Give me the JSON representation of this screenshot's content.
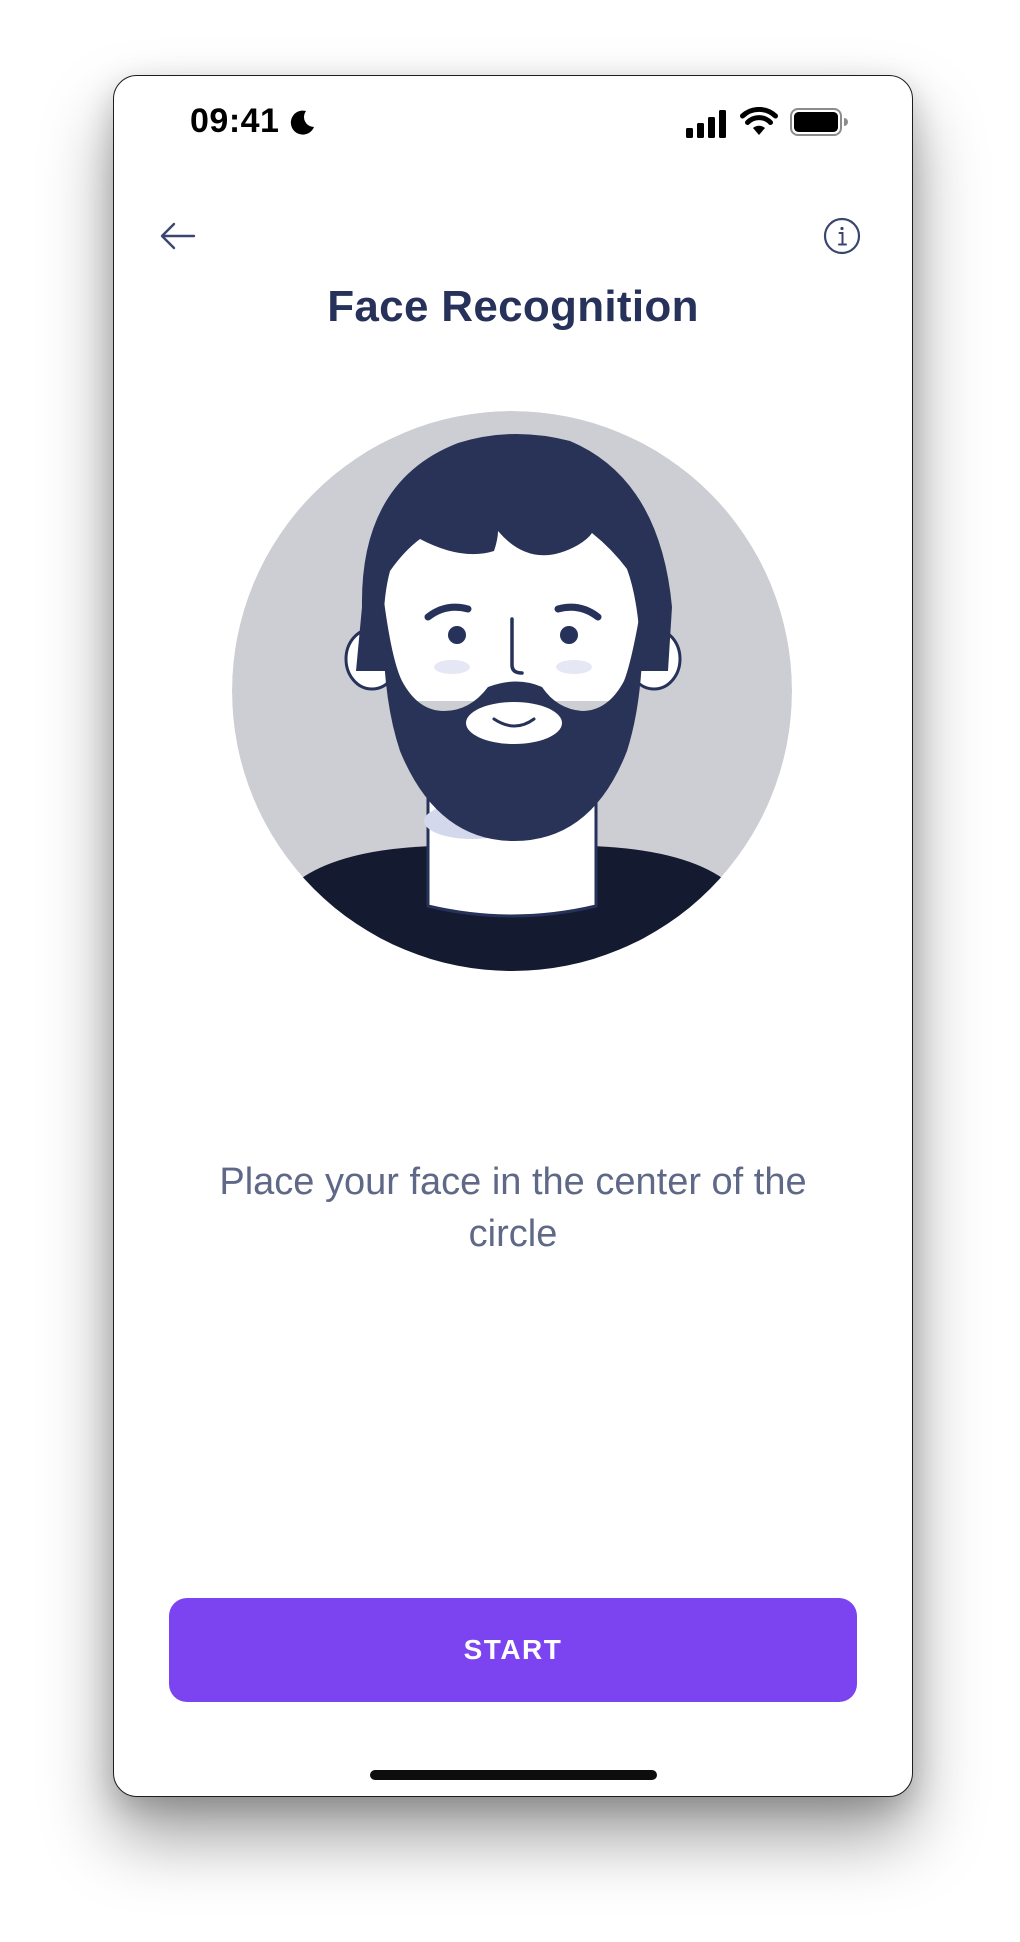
{
  "status_bar": {
    "time": "09:41",
    "icons": [
      "moon-icon",
      "cellular-signal-icon",
      "wifi-icon",
      "battery-icon"
    ]
  },
  "nav": {
    "back_icon": "arrow-left-icon",
    "info_icon": "info-circle-icon"
  },
  "title": "Face Recognition",
  "illustration": "bearded-man-avatar",
  "instruction": "Place your face in the center of the circle",
  "start_button": {
    "label": "START"
  },
  "colors": {
    "title": "#26325a",
    "hair_beard": "#283357",
    "shirt": "#141a30",
    "circle_bg": "#cdced3",
    "body_text": "#5f6987",
    "accent": "#7b44f0"
  }
}
